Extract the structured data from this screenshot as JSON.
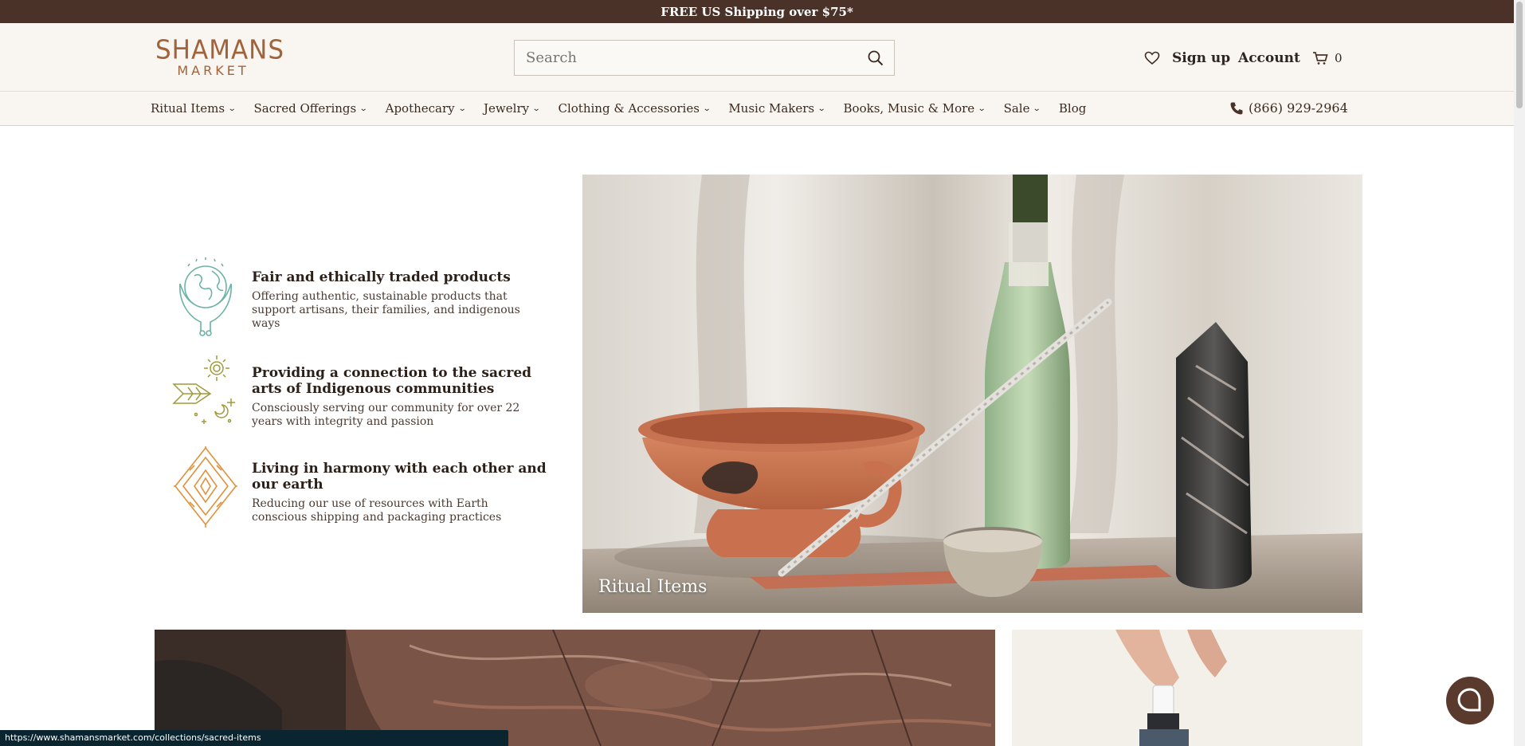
{
  "announcement": "FREE US Shipping over $75*",
  "logo": {
    "line1": "SHAMANS",
    "line2": "MARKET"
  },
  "search": {
    "placeholder": "Search"
  },
  "header": {
    "signup": "Sign up",
    "account": "Account",
    "cart_count": "0"
  },
  "nav": {
    "items": [
      {
        "label": "Ritual Items"
      },
      {
        "label": "Sacred Offerings"
      },
      {
        "label": "Apothecary"
      },
      {
        "label": "Jewelry"
      },
      {
        "label": "Clothing & Accessories"
      },
      {
        "label": "Music Makers"
      },
      {
        "label": "Books, Music & More"
      },
      {
        "label": "Sale"
      },
      {
        "label": "Blog"
      }
    ],
    "phone": "(866) 929-2964"
  },
  "values": [
    {
      "title": "Fair and ethically traded products",
      "text": "Offering authentic, sustainable products that support artisans, their families, and indigenous ways",
      "icon": "earth-in-hands-icon"
    },
    {
      "title": "Providing a connection to the sacred arts of Indigenous communities",
      "text": "Consciously serving our community for over 22 years with integrity and passion",
      "icon": "sun-moon-arrow-icon"
    },
    {
      "title": "Living in harmony with each other and our earth",
      "text": "Reducing our use of resources with Earth conscious shipping and packaging practices",
      "icon": "diamond-pattern-icon"
    }
  ],
  "hero": {
    "caption": "Ritual Items"
  },
  "status_url": "https://www.shamansmarket.com/collections/sacred-items",
  "colors": {
    "announcement_bg": "#4a3228",
    "header_bg": "#f9f6f1",
    "logo": "#a2623a",
    "icon_teal": "#6bb3a5",
    "icon_olive": "#a09a3a",
    "icon_orange": "#e0913a"
  }
}
